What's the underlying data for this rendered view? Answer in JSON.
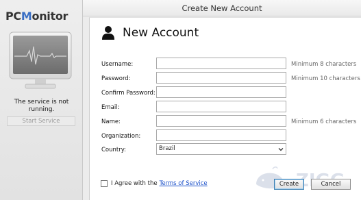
{
  "sidebar": {
    "logo": {
      "pc": "PC",
      "m": "M",
      "rest": "onitor"
    },
    "service_status": "The service is not running.",
    "start_service_label": "Start Service"
  },
  "window": {
    "title": "Create New Account"
  },
  "form": {
    "heading": "New Account",
    "fields": {
      "username": {
        "label": "Username:",
        "value": "",
        "hint": "Minimum 8 characters"
      },
      "password": {
        "label": "Password:",
        "value": "",
        "hint": "Minimum 10 characters"
      },
      "confirm_password": {
        "label": "Confirm Password:",
        "value": ""
      },
      "email": {
        "label": "Email:",
        "value": ""
      },
      "name": {
        "label": "Name:",
        "value": "",
        "hint": "Minimum 6 characters"
      },
      "organization": {
        "label": "Organization:",
        "value": ""
      },
      "country": {
        "label": "Country:",
        "value": "Brazil"
      }
    },
    "agree_text": "I Agree with the",
    "terms_link": "Terms of Service",
    "create_label": "Create",
    "cancel_label": "Cancel"
  },
  "watermark": {
    "text": "ZIGG"
  },
  "colors": {
    "accent": "#3a6fc4",
    "link": "#1a4fc9",
    "default_button_border": "#3c7fb1"
  },
  "icons": {
    "heading": "user-icon",
    "monitor": "monitor-heartbeat-icon",
    "dropdown": "chevron-down-icon"
  }
}
